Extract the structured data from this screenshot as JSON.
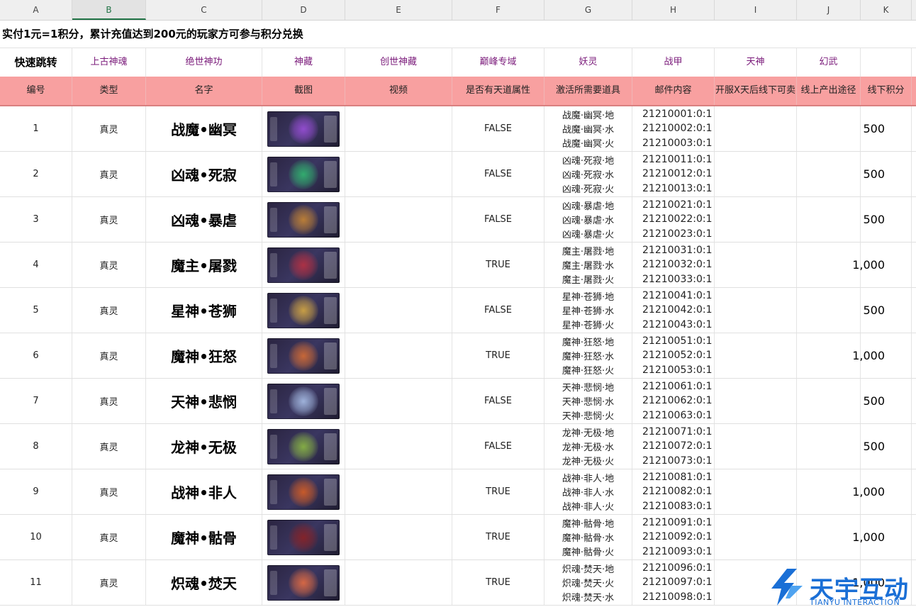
{
  "column_letters": [
    "A",
    "B",
    "C",
    "D",
    "E",
    "F",
    "G",
    "H",
    "I",
    "J",
    "K"
  ],
  "selected_column": "B",
  "banner": "实付1元=1积分，累计充值达到200元的玩家方可参与积分兑换",
  "jump": {
    "label": "快速跳转",
    "links": [
      "上古神魂",
      "绝世神功",
      "神藏",
      "创世神藏",
      "巅峰专域",
      "妖灵",
      "战甲",
      "天神",
      "幻武"
    ]
  },
  "headers": [
    "编号",
    "类型",
    "名字",
    "截图",
    "视频",
    "是否有天道属性",
    "激活所需要道具",
    "邮件内容",
    "开服X天后线下可卖",
    "线上产出途径",
    "线下积分"
  ],
  "rows": [
    {
      "id": "1",
      "type": "真灵",
      "name": "战魔•幽冥",
      "tiandao": "FALSE",
      "items": [
        "战魔·幽冥·地",
        "战魔·幽冥·水",
        "战魔·幽冥·火"
      ],
      "mail": [
        "21210001:0:1",
        "21210002:0:1",
        "21210003:0:1"
      ],
      "points": "500",
      "thumb_color": "#a050e0"
    },
    {
      "id": "2",
      "type": "真灵",
      "name": "凶魂•死寂",
      "tiandao": "FALSE",
      "items": [
        "凶魂·死寂·地",
        "凶魂·死寂·水",
        "凶魂·死寂·火"
      ],
      "mail": [
        "21210011:0:1",
        "21210012:0:1",
        "21210013:0:1"
      ],
      "points": "500",
      "thumb_color": "#30c070"
    },
    {
      "id": "3",
      "type": "真灵",
      "name": "凶魂•暴虐",
      "tiandao": "FALSE",
      "items": [
        "凶魂·暴虐·地",
        "凶魂·暴虐·水",
        "凶魂·暴虐·火"
      ],
      "mail": [
        "21210021:0:1",
        "21210022:0:1",
        "21210023:0:1"
      ],
      "points": "500",
      "thumb_color": "#d08a30"
    },
    {
      "id": "4",
      "type": "真灵",
      "name": "魔主•屠戮",
      "tiandao": "TRUE",
      "items": [
        "魔主·屠戮·地",
        "魔主·屠戮·水",
        "魔主·屠戮·火"
      ],
      "mail": [
        "21210031:0:1",
        "21210032:0:1",
        "21210033:0:1"
      ],
      "points": "1,000",
      "thumb_color": "#c03040"
    },
    {
      "id": "5",
      "type": "真灵",
      "name": "星神•苍狮",
      "tiandao": "FALSE",
      "items": [
        "星神·苍狮·地",
        "星神·苍狮·水",
        "星神·苍狮·火"
      ],
      "mail": [
        "21210041:0:1",
        "21210042:0:1",
        "21210043:0:1"
      ],
      "points": "500",
      "thumb_color": "#e0b040"
    },
    {
      "id": "6",
      "type": "真灵",
      "name": "魔神•狂怒",
      "tiandao": "TRUE",
      "items": [
        "魔神·狂怒·地",
        "魔神·狂怒·水",
        "魔神·狂怒·火"
      ],
      "mail": [
        "21210051:0:1",
        "21210052:0:1",
        "21210053:0:1"
      ],
      "points": "1,000",
      "thumb_color": "#e07030"
    },
    {
      "id": "7",
      "type": "真灵",
      "name": "天神•悲悯",
      "tiandao": "FALSE",
      "items": [
        "天神·悲悯·地",
        "天神·悲悯·水",
        "天神·悲悯·火"
      ],
      "mail": [
        "21210061:0:1",
        "21210062:0:1",
        "21210063:0:1"
      ],
      "points": "500",
      "thumb_color": "#b0c8f0"
    },
    {
      "id": "8",
      "type": "真灵",
      "name": "龙神•无极",
      "tiandao": "FALSE",
      "items": [
        "龙神·无极·地",
        "龙神·无极·水",
        "龙神·无极·火"
      ],
      "mail": [
        "21210071:0:1",
        "21210072:0:1",
        "21210073:0:1"
      ],
      "points": "500",
      "thumb_color": "#90c040"
    },
    {
      "id": "9",
      "type": "真灵",
      "name": "战神•非人",
      "tiandao": "TRUE",
      "items": [
        "战神·非人·地",
        "战神·非人·水",
        "战神·非人·火"
      ],
      "mail": [
        "21210081:0:1",
        "21210082:0:1",
        "21210083:0:1"
      ],
      "points": "1,000",
      "thumb_color": "#e06020"
    },
    {
      "id": "10",
      "type": "真灵",
      "name": "魔神•骷骨",
      "tiandao": "TRUE",
      "items": [
        "魔神·骷骨·地",
        "魔神·骷骨·水",
        "魔神·骷骨·火"
      ],
      "mail": [
        "21210091:0:1",
        "21210092:0:1",
        "21210093:0:1"
      ],
      "points": "1,000",
      "thumb_color": "#902020"
    },
    {
      "id": "11",
      "type": "真灵",
      "name": "炽魂•焚天",
      "tiandao": "TRUE",
      "items": [
        "炽魂·焚天·地",
        "炽魂·焚天·火",
        "炽魂·焚天·水"
      ],
      "mail": [
        "21210096:0:1",
        "21210097:0:1",
        "21210098:0:1"
      ],
      "points": "1,000",
      "thumb_color": "#f07040"
    }
  ],
  "logo": {
    "text": "天宇互动",
    "sub": "TIANYU INTERACTION",
    "color": "#1a6fd6"
  }
}
